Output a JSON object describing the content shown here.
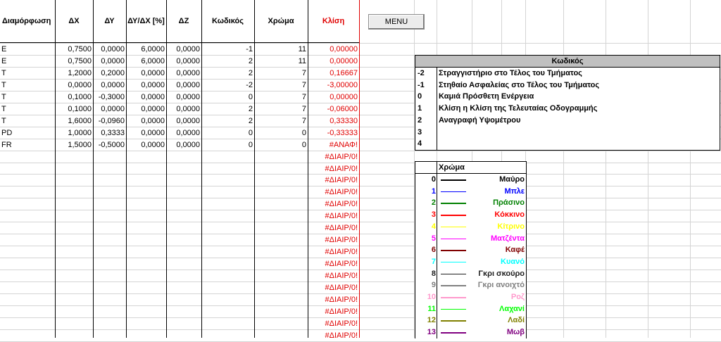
{
  "headers": [
    "Διαμόρφωση",
    "ΔΧ",
    "ΔΥ",
    "ΔΥ/ΔΧ [%]",
    "ΔΖ",
    "Κωδικός",
    "Χρώμα",
    "Κλίση"
  ],
  "menu_label": "MENU",
  "rows": [
    {
      "type": "E",
      "dx": "0,7500",
      "dy": "0,0000",
      "dydx": "6,0000",
      "dz": "0,0000",
      "code": "-1",
      "color": "11",
      "slope": "0,00000"
    },
    {
      "type": "E",
      "dx": "0,7500",
      "dy": "0,0000",
      "dydx": "6,0000",
      "dz": "0,0000",
      "code": "2",
      "color": "11",
      "slope": "0,00000"
    },
    {
      "type": "T",
      "dx": "1,2000",
      "dy": "0,2000",
      "dydx": "0,0000",
      "dz": "0,0000",
      "code": "2",
      "color": "7",
      "slope": "0,16667"
    },
    {
      "type": "T",
      "dx": "0,0000",
      "dy": "0,0000",
      "dydx": "0,0000",
      "dz": "0,0000",
      "code": "-2",
      "color": "7",
      "slope": "-3,00000"
    },
    {
      "type": "T",
      "dx": "0,1000",
      "dy": "-0,3000",
      "dydx": "0,0000",
      "dz": "0,0000",
      "code": "0",
      "color": "7",
      "slope": "0,00000"
    },
    {
      "type": "T",
      "dx": "0,1000",
      "dy": "0,0000",
      "dydx": "0,0000",
      "dz": "0,0000",
      "code": "2",
      "color": "7",
      "slope": "-0,06000"
    },
    {
      "type": "T",
      "dx": "1,6000",
      "dy": "-0,0960",
      "dydx": "0,0000",
      "dz": "0,0000",
      "code": "2",
      "color": "7",
      "slope": "0,33330"
    },
    {
      "type": "PD",
      "dx": "1,0000",
      "dy": "0,3333",
      "dydx": "0,0000",
      "dz": "0,0000",
      "code": "0",
      "color": "0",
      "slope": "-0,33333"
    },
    {
      "type": "FR",
      "dx": "1,5000",
      "dy": "-0,5000",
      "dydx": "0,0000",
      "dz": "0,0000",
      "code": "0",
      "color": "0",
      "slope": "#ΑΝΑΦ!"
    }
  ],
  "error_cells": [
    "#ΔΙΑΙΡ/0!",
    "#ΔΙΑΙΡ/0!",
    "#ΔΙΑΙΡ/0!",
    "#ΔΙΑΙΡ/0!",
    "#ΔΙΑΙΡ/0!",
    "#ΔΙΑΙΡ/0!",
    "#ΔΙΑΙΡ/0!",
    "#ΔΙΑΙΡ/0!",
    "#ΔΙΑΙΡ/0!",
    "#ΔΙΑΙΡ/0!",
    "#ΔΙΑΙΡ/0!",
    "#ΔΙΑΙΡ/0!",
    "#ΔΙΑΙΡ/0!",
    "#ΔΙΑΙΡ/0!",
    "#ΔΙΑΙΡ/0!",
    "#ΔΙΑΙΡ/0!"
  ],
  "code_table": {
    "title": "Κωδικός",
    "rows": [
      {
        "num": "-2",
        "desc": "Στραγγιστήριο στο Τέλος του Τμήματος"
      },
      {
        "num": "-1",
        "desc": "Στηθαίο Ασφαλείας στο Τέλος του Τμήματος"
      },
      {
        "num": "0",
        "desc": "Καμιά Πρόσθετη Ενέργεια"
      },
      {
        "num": "1",
        "desc": "Κλίση η Κλίση της Τελευταίας Οδογραμμής"
      },
      {
        "num": "2",
        "desc": "Αναγραφή Υψομέτρου"
      },
      {
        "num": "3",
        "desc": ""
      },
      {
        "num": "4",
        "desc": ""
      }
    ]
  },
  "color_table": {
    "title": "Χρώμα",
    "rows": [
      {
        "num": "0",
        "name": "Μαύρο",
        "color": "#000000"
      },
      {
        "num": "1",
        "name": "Μπλε",
        "color": "#0000ff"
      },
      {
        "num": "2",
        "name": "Πράσινο",
        "color": "#008000"
      },
      {
        "num": "3",
        "name": "Κόκκινο",
        "color": "#ff0000"
      },
      {
        "num": "4",
        "name": "Κίτρινο",
        "color": "#ffff00"
      },
      {
        "num": "5",
        "name": "Ματζέντα",
        "color": "#ff00ff"
      },
      {
        "num": "6",
        "name": "Καφέ",
        "color": "#800000"
      },
      {
        "num": "7",
        "name": "Κυανό",
        "color": "#00ffff"
      },
      {
        "num": "8",
        "name": "Γκρι σκούρο",
        "color": "#202020"
      },
      {
        "num": "9",
        "name": "Γκρι ανοιχτό",
        "color": "#808080"
      },
      {
        "num": "10",
        "name": "Ροζ",
        "color": "#ff99cc"
      },
      {
        "num": "11",
        "name": "Λαχανί",
        "color": "#00ff00"
      },
      {
        "num": "12",
        "name": "Λαδί",
        "color": "#808000"
      },
      {
        "num": "13",
        "name": "Μωβ",
        "color": "#800080"
      }
    ]
  }
}
